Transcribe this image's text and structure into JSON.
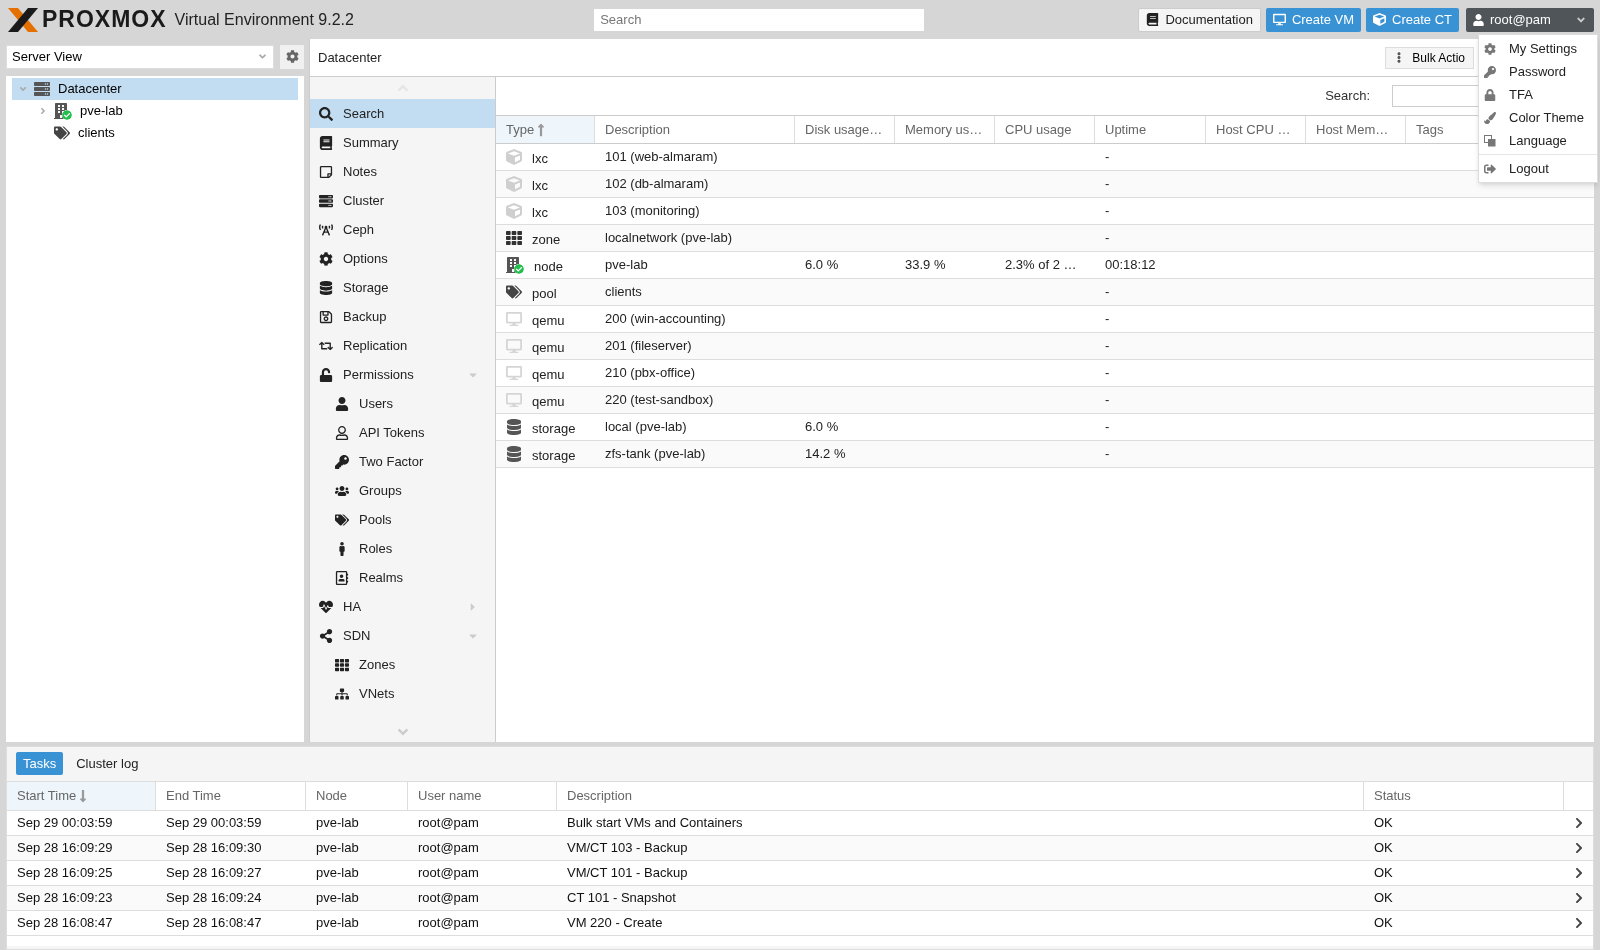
{
  "header": {
    "logo_text": "PROXMOX",
    "product": "Virtual Environment 9.2.2",
    "search_placeholder": "Search",
    "buttons": [
      {
        "label": "Documentation",
        "kind": "docs"
      },
      {
        "label": "Create VM",
        "kind": "vm"
      },
      {
        "label": "Create CT",
        "kind": "ct"
      }
    ],
    "user": "root@pam"
  },
  "user_menu": {
    "items": [
      {
        "label": "My Settings"
      },
      {
        "label": "Password"
      },
      {
        "label": "TFA"
      },
      {
        "label": "Color Theme"
      },
      {
        "label": "Language"
      },
      {
        "label": "Logout"
      }
    ]
  },
  "view_selector": {
    "value": "Server View"
  },
  "tree": [
    {
      "label": "Datacenter",
      "kind": "datacenter",
      "selected": true,
      "expanded": true,
      "children": [
        {
          "label": "pve-lab",
          "kind": "node",
          "selected": false,
          "expanded": false
        },
        {
          "label": "clients",
          "kind": "pool",
          "selected": false
        }
      ]
    }
  ],
  "panel": {
    "title": "Datacenter",
    "bulk_button": "Bulk Actio",
    "search_label": "Search:"
  },
  "nav": [
    {
      "label": "Search",
      "selected": true
    },
    {
      "label": "Summary",
      "selected": false
    },
    {
      "label": "Notes",
      "selected": false
    },
    {
      "label": "Cluster",
      "selected": false
    },
    {
      "label": "Ceph",
      "selected": false
    },
    {
      "label": "Options",
      "selected": false
    },
    {
      "label": "Storage",
      "selected": false
    },
    {
      "label": "Backup",
      "selected": false
    },
    {
      "label": "Replication",
      "selected": false
    },
    {
      "label": "Permissions",
      "selected": false,
      "expanded": true,
      "children": [
        {
          "label": "Users",
          "selected": false
        },
        {
          "label": "API Tokens",
          "selected": false
        },
        {
          "label": "Two Factor",
          "selected": false
        },
        {
          "label": "Groups",
          "selected": false
        },
        {
          "label": "Pools",
          "selected": false
        },
        {
          "label": "Roles",
          "selected": false
        },
        {
          "label": "Realms",
          "selected": false
        }
      ]
    },
    {
      "label": "HA",
      "selected": false,
      "expanded": false
    },
    {
      "label": "SDN",
      "selected": false,
      "expanded": true,
      "children": [
        {
          "label": "Zones",
          "selected": false
        },
        {
          "label": "VNets",
          "selected": false
        }
      ]
    }
  ],
  "grid": {
    "columns": [
      {
        "label": "Type",
        "sort_ascending": true
      },
      {
        "label": "Description"
      },
      {
        "label": "Disk usage…"
      },
      {
        "label": "Memory us…"
      },
      {
        "label": "CPU usage"
      },
      {
        "label": "Uptime"
      },
      {
        "label": "Host CPU …"
      },
      {
        "label": "Host Mem…"
      },
      {
        "label": "Tags"
      }
    ],
    "rows": [
      {
        "kind": "container",
        "type": "lxc",
        "description": "101 (web-almaram)",
        "uptime": "-"
      },
      {
        "kind": "container",
        "type": "lxc",
        "description": "102 (db-almaram)",
        "uptime": "-"
      },
      {
        "kind": "container",
        "type": "lxc",
        "description": "103 (monitoring)",
        "uptime": "-"
      },
      {
        "kind": "zone",
        "type": "zone",
        "description": "localnetwork (pve-lab)",
        "uptime": "-"
      },
      {
        "kind": "node",
        "type": "node",
        "description": "pve-lab",
        "disk": "6.0 %",
        "memory": "33.9 %",
        "cpu": "2.3% of 2 …",
        "uptime": "00:18:12"
      },
      {
        "kind": "pool",
        "type": "pool",
        "description": "clients",
        "uptime": "-"
      },
      {
        "kind": "vm",
        "type": "qemu",
        "description": "200 (win-accounting)",
        "uptime": "-"
      },
      {
        "kind": "vm",
        "type": "qemu",
        "description": "201 (fileserver)",
        "uptime": "-"
      },
      {
        "kind": "vm",
        "type": "qemu",
        "description": "210 (pbx-office)",
        "uptime": "-"
      },
      {
        "kind": "vm",
        "type": "qemu",
        "description": "220 (test-sandbox)",
        "uptime": "-"
      },
      {
        "kind": "storage",
        "type": "storage",
        "description": "local (pve-lab)",
        "disk": "6.0 %",
        "uptime": "-"
      },
      {
        "kind": "storage",
        "type": "storage",
        "description": "zfs-tank (pve-lab)",
        "disk": "14.2 %",
        "uptime": "-"
      }
    ]
  },
  "bottom_tabs": [
    {
      "label": "Tasks",
      "selected": true
    },
    {
      "label": "Cluster log",
      "selected": false
    }
  ],
  "tasks": {
    "columns": [
      {
        "label": "Start Time",
        "sort_ascending": false
      },
      {
        "label": "End Time"
      },
      {
        "label": "Node"
      },
      {
        "label": "User name"
      },
      {
        "label": "Description"
      },
      {
        "label": "Status"
      }
    ],
    "rows": [
      {
        "start": "Sep 29 00:03:59",
        "end": "Sep 29 00:03:59",
        "node": "pve-lab",
        "user": "root@pam",
        "description": "Bulk start VMs and Containers",
        "status": "OK"
      },
      {
        "start": "Sep 28 16:09:29",
        "end": "Sep 28 16:09:30",
        "node": "pve-lab",
        "user": "root@pam",
        "description": "VM/CT 103 - Backup",
        "status": "OK"
      },
      {
        "start": "Sep 28 16:09:25",
        "end": "Sep 28 16:09:27",
        "node": "pve-lab",
        "user": "root@pam",
        "description": "VM/CT 101 - Backup",
        "status": "OK"
      },
      {
        "start": "Sep 28 16:09:23",
        "end": "Sep 28 16:09:24",
        "node": "pve-lab",
        "user": "root@pam",
        "description": "CT 101 - Snapshot",
        "status": "OK"
      },
      {
        "start": "Sep 28 16:08:47",
        "end": "Sep 28 16:08:47",
        "node": "pve-lab",
        "user": "root@pam",
        "description": "VM 220 - Create",
        "status": "OK"
      }
    ]
  }
}
